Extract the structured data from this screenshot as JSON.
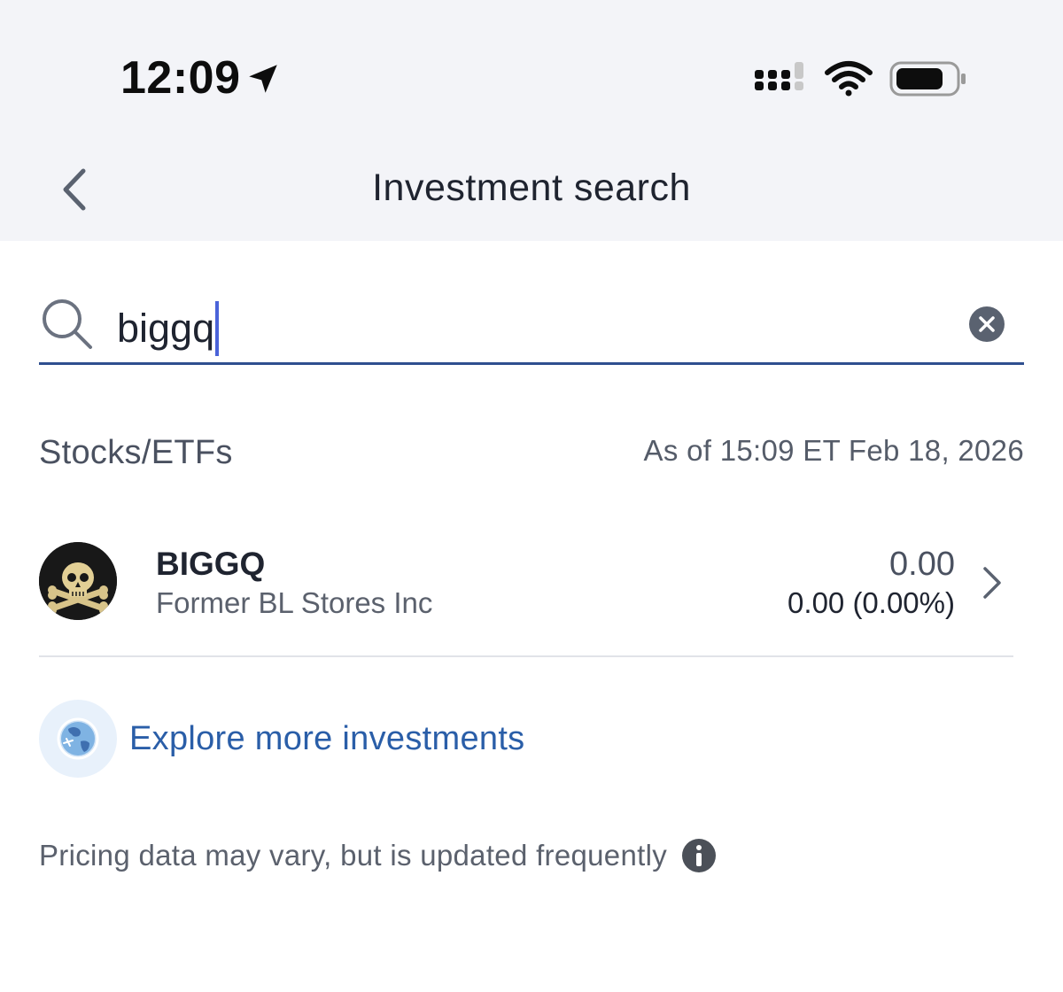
{
  "status_bar": {
    "time": "12:09",
    "icons": [
      "location-arrow-icon",
      "cellular-signal-icon",
      "wifi-icon",
      "battery-icon"
    ]
  },
  "nav": {
    "title": "Investment search",
    "back_icon": "chevron-left-icon"
  },
  "search": {
    "value": "biggq",
    "icon": "search-icon",
    "clear_icon": "clear-circle-icon"
  },
  "section": {
    "title": "Stocks/ETFs",
    "as_of": "As of 15:09 ET Feb 18, 2026"
  },
  "results": [
    {
      "ticker": "BIGGQ",
      "company": "Former BL Stores Inc",
      "price": "0.00",
      "change": "0.00 (0.00%)",
      "avatar_icon": "skull-crossbones-icon"
    }
  ],
  "explore": {
    "label": "Explore more investments",
    "icon": "globe-icon"
  },
  "footnote": {
    "text": "Pricing data may vary, but is updated frequently",
    "icon": "info-icon"
  },
  "colors": {
    "header_bg": "#f3f4f8",
    "accent": "#2a5ea8",
    "underline": "#2f4f8f",
    "caret": "#4a63d9"
  }
}
